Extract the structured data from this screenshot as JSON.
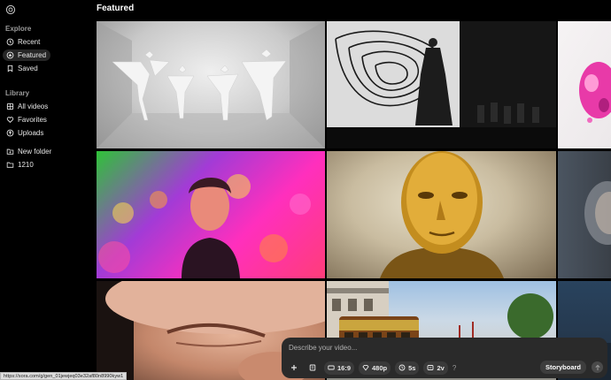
{
  "header": {
    "title": "Featured"
  },
  "sidebar": {
    "explore_title": "Explore",
    "explore_items": [
      {
        "label": "Recent",
        "icon": "clock-icon"
      },
      {
        "label": "Featured",
        "icon": "star-icon",
        "active": true
      },
      {
        "label": "Saved",
        "icon": "bookmark-icon"
      }
    ],
    "library_title": "Library",
    "library_items": [
      {
        "label": "All videos",
        "icon": "grid-icon"
      },
      {
        "label": "Favorites",
        "icon": "heart-icon"
      },
      {
        "label": "Uploads",
        "icon": "upload-icon"
      }
    ],
    "folder_items": [
      {
        "label": "New folder",
        "icon": "folder-plus-icon"
      },
      {
        "label": "1210",
        "icon": "folder-icon"
      }
    ]
  },
  "composer": {
    "placeholder": "Describe your video...",
    "aspect_ratio": "16:9",
    "resolution": "480p",
    "duration": "5s",
    "variations": "2v",
    "help": "?",
    "storyboard_label": "Storyboard"
  },
  "status_bar": {
    "url": "https://sora.com/g/gen_01jewjeq03e32af80n8990kyw1"
  },
  "colors": {
    "background": "#000000",
    "composer_bg": "#2a2a2a",
    "active_nav_bg": "#262626"
  }
}
